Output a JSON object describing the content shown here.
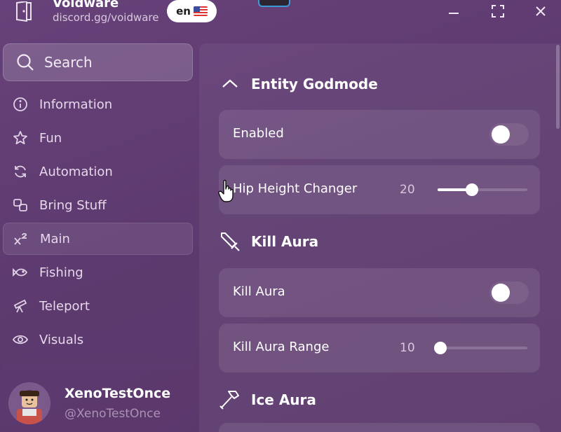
{
  "app": {
    "title": "Voidware",
    "subtitle": "discord.gg/voidware",
    "language": "en",
    "icon": "door-logo-icon"
  },
  "window_controls": [
    "minimize-icon",
    "maximize-icon",
    "close-icon"
  ],
  "search": {
    "label": "Search",
    "icon": "search-icon"
  },
  "sidebar": {
    "items": [
      {
        "label": "Information",
        "icon": "info-icon",
        "active": false
      },
      {
        "label": "Fun",
        "icon": "star-icon",
        "active": false
      },
      {
        "label": "Automation",
        "icon": "refresh-icon",
        "active": false
      },
      {
        "label": "Bring Stuff",
        "icon": "bring-icon",
        "active": false
      },
      {
        "label": "Main",
        "icon": "superscript-icon",
        "active": true
      },
      {
        "label": "Fishing",
        "icon": "fish-icon",
        "active": false
      },
      {
        "label": "Teleport",
        "icon": "telescope-icon",
        "active": false
      },
      {
        "label": "Visuals",
        "icon": "eye-icon",
        "active": false
      }
    ]
  },
  "profile": {
    "name": "XenoTestOnce",
    "handle": "@XenoTestOnce"
  },
  "sections": {
    "entity_godmode": {
      "title": "Entity Godmode",
      "icon": "chevron-up-icon",
      "enabled_label": "Enabled",
      "enabled_value": false,
      "hip_label": "Hip Height Changer",
      "hip_value": "20",
      "hip_fraction": 0.38
    },
    "kill_aura": {
      "title": "Kill Aura",
      "icon": "sword-icon",
      "toggle_label": "Kill Aura",
      "toggle_value": false,
      "range_label": "Kill Aura Range",
      "range_value": "10",
      "range_fraction": 0.0
    },
    "ice_aura": {
      "title": "Ice Aura",
      "icon": "hammer-icon"
    }
  },
  "colors": {
    "background": "#5f3a70",
    "knob": "#ffffff",
    "accent_outline": "#3a9bd8"
  }
}
